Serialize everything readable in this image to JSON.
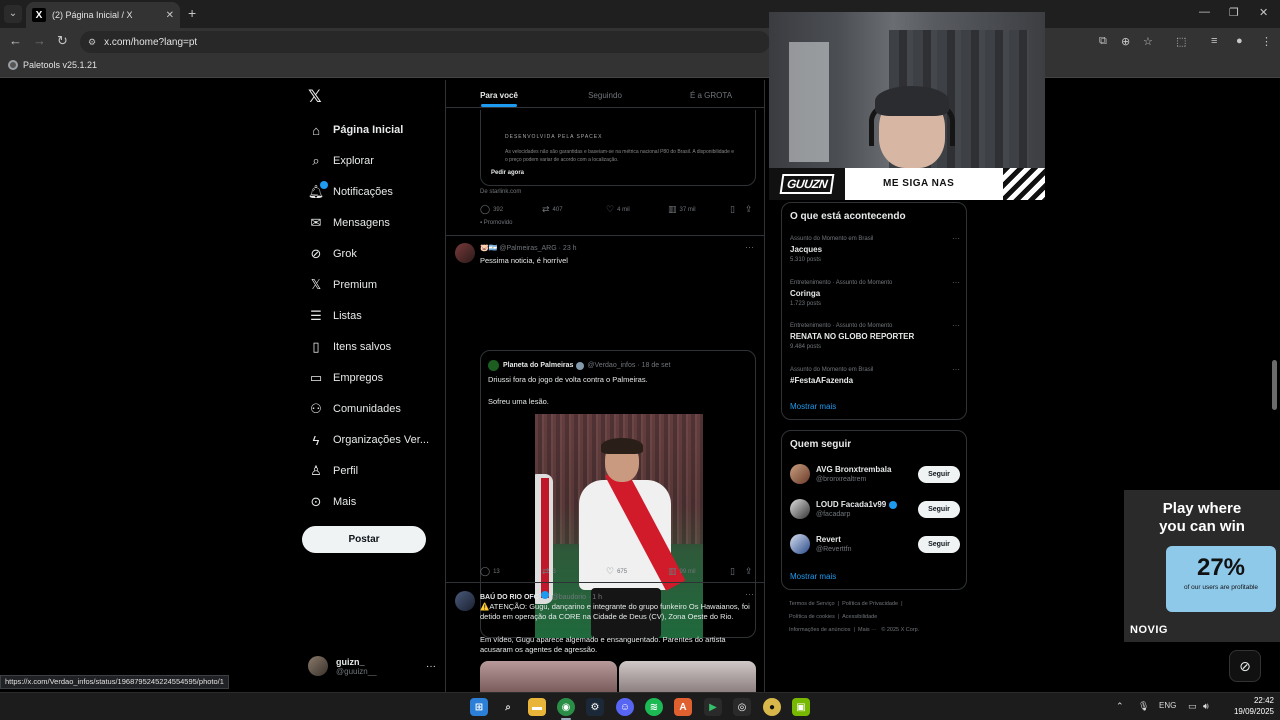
{
  "browser": {
    "tab_title": "(2) Página Inicial / X",
    "url": "x.com/home?lang=pt",
    "bookmark": "Paletools v25.1.21",
    "status_url": "https://x.com/Verdao_infos/status/1968795245224554595/photo/1"
  },
  "nav": {
    "items": [
      {
        "label": "Página Inicial",
        "icon": "home-icon"
      },
      {
        "label": "Explorar",
        "icon": "search-icon"
      },
      {
        "label": "Notificações",
        "icon": "bell-icon"
      },
      {
        "label": "Mensagens",
        "icon": "mail-icon"
      },
      {
        "label": "Grok",
        "icon": "grok-icon"
      },
      {
        "label": "Premium",
        "icon": "x-icon"
      },
      {
        "label": "Listas",
        "icon": "list-icon"
      },
      {
        "label": "Itens salvos",
        "icon": "bookmark-icon"
      },
      {
        "label": "Empregos",
        "icon": "briefcase-icon"
      },
      {
        "label": "Comunidades",
        "icon": "people-icon"
      },
      {
        "label": "Organizações Ver...",
        "icon": "lightning-icon"
      },
      {
        "label": "Perfil",
        "icon": "person-icon"
      },
      {
        "label": "Mais",
        "icon": "more-circle-icon"
      }
    ],
    "post_button": "Postar",
    "account_name": "guizn_",
    "account_handle": "@guuizn__"
  },
  "timeline": {
    "tabs": [
      "Para você",
      "Seguindo",
      "É a GROTA"
    ],
    "ad": {
      "brand": "DESENVOLVIDA PELA SPACEX",
      "fine_print": "As velocidades não são garantidas e baseiam-se na métrica nacional P80 do Brasil. A disponibilidade e o preço podem variar de acordo com a localização.",
      "cta": "Pedir agora",
      "source": "De starlink.com",
      "replies": "392",
      "reposts": "407",
      "likes": "4 mil",
      "views": "37 mil",
      "promoted": "Promovido"
    },
    "post1": {
      "handle": "@Palmeiras_ARG",
      "time": "23 h",
      "text": "Pessima noticia, é horrível",
      "quote": {
        "name": "Planeta do Palmeiras",
        "handle": "@Verdao_infos",
        "date": "18 de set",
        "line1": "Driussi fora do jogo de volta contra o Palmeiras.",
        "line2": "Sofreu uma lesão."
      },
      "replies": "13",
      "reposts": "3",
      "likes": "675",
      "views": "99 mil"
    },
    "post2": {
      "name": "BAÚ DO RIO OFC",
      "handle": "@baudorio",
      "time": "1 h",
      "text1": "⚠️ATENÇÃO: Gugu, dançarino e integrante do grupo funkeiro Os Hawaianos, foi detido em operação da CORE na Cidade de Deus (CV), Zona Oeste do Rio.",
      "text2": "Em vídeo, Gugu aparece algemado e ensanguentado. Parentes do artista acusaram os agentes de agressão."
    }
  },
  "trends": {
    "title": "O que está acontecendo",
    "items": [
      {
        "context": "Assunto do Momento em Brasil",
        "name": "Jacques",
        "posts": "5.310 posts"
      },
      {
        "context": "Entretenimento · Assunto do Momento",
        "name": "Coringa",
        "posts": "1.723 posts"
      },
      {
        "context": "Entretenimento · Assunto do Momento",
        "name": "RENATA NO GLOBO REPORTER",
        "posts": "9.484 posts"
      },
      {
        "context": "Assunto do Momento em Brasil",
        "name": "#FestaAFazenda",
        "posts": ""
      }
    ],
    "show_more": "Mostrar mais"
  },
  "who_to_follow": {
    "title": "Quem seguir",
    "items": [
      {
        "name": "AVG Bronxtrembala",
        "handle": "@bronxrealtrem",
        "verified": false
      },
      {
        "name": "LOUD Facada1v99",
        "handle": "@facadarp",
        "verified": true
      },
      {
        "name": "Revert",
        "handle": "@Reverttfn",
        "verified": false
      }
    ],
    "follow_label": "Seguir",
    "show_more": "Mostrar mais"
  },
  "footer": {
    "links": [
      "Termos de Serviço",
      "Política de Privacidade",
      "Política de cookies",
      "Acessibilidade",
      "Informações de anúncios",
      "Mais ···",
      "© 2025 X Corp."
    ]
  },
  "overlays": {
    "webcam_badge": "GUUZN",
    "webcam_text": "ME SIGA NAS",
    "ad_headline_1": "Play where",
    "ad_headline_2": "you can win",
    "ad_percent": "27%",
    "ad_sub": "of our users are profitable",
    "ad_brand": "NOVIG"
  },
  "taskbar": {
    "language": "ENG",
    "time": "22:42",
    "date": "19/09/2025"
  },
  "colors": {
    "accent": "#1d9bf0",
    "background": "#000000",
    "border": "#2f3336",
    "muted_text": "#71767b"
  }
}
